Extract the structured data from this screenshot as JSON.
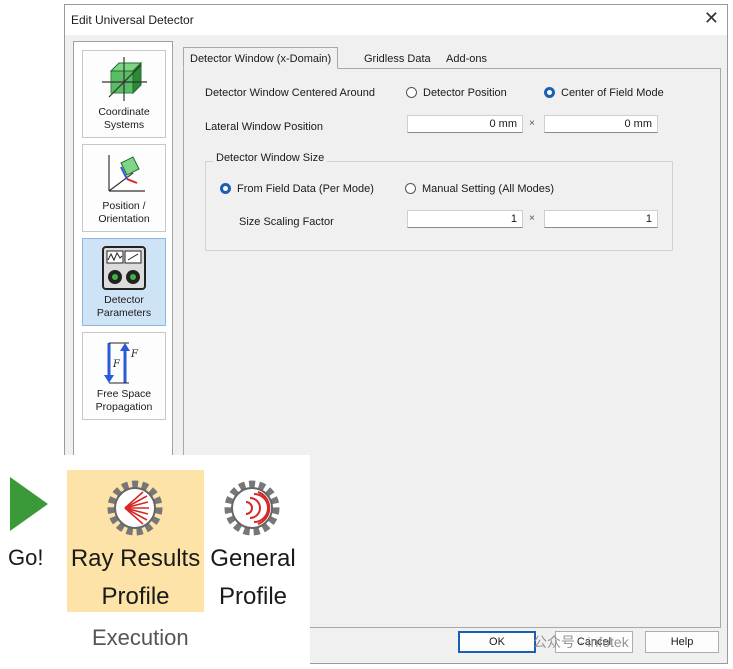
{
  "dialog": {
    "title": "Edit Universal Detector",
    "close_glyph": "✕"
  },
  "sidebar": {
    "items": [
      {
        "label_line1": "Coordinate",
        "label_line2": "Systems",
        "icon": "coordinate-systems-icon"
      },
      {
        "label_line1": "Position /",
        "label_line2": "Orientation",
        "icon": "position-orientation-icon"
      },
      {
        "label_line1": "Detector",
        "label_line2": "Parameters",
        "icon": "detector-parameters-icon",
        "selected": true
      },
      {
        "label_line1": "Free Space",
        "label_line2": "Propagation",
        "icon": "free-space-propagation-icon"
      }
    ]
  },
  "tabs": [
    {
      "label": "Detector Window (x-Domain)",
      "active": true
    },
    {
      "label": "Gridless Data",
      "active": false
    },
    {
      "label": "Add-ons",
      "active": false
    }
  ],
  "form": {
    "centered_around_label": "Detector Window Centered Around",
    "radio_detector_position": "Detector Position",
    "radio_center_field_mode": "Center of Field Mode",
    "center_selected": "Center of Field Mode",
    "lateral_position_label": "Lateral Window Position",
    "lateral_x": "0 mm",
    "lateral_y": "0 mm",
    "times_sign": "×",
    "size_group_title": "Detector Window Size",
    "radio_from_field": "From Field Data (Per Mode)",
    "radio_manual": "Manual Setting (All Modes)",
    "size_selected": "From Field Data (Per Mode)",
    "scaling_label": "Size Scaling Factor",
    "scaling_x": "1",
    "scaling_y": "1"
  },
  "buttons": {
    "ok": "OK",
    "cancel": "Cancel",
    "help": "Help"
  },
  "ribbon": {
    "go_label": "Go!",
    "ray_results_line1": "Ray Results",
    "ray_results_line2": "Profile",
    "general_line1": "General",
    "general_line2": "Profile",
    "group_label": "Execution",
    "highlight_color": "#fde3a7",
    "go_color": "#3a9a3a"
  },
  "watermark": "公众号 · infotek",
  "colors": {
    "accent": "#1a5fb4",
    "selected_sidebar": "#cfe3f6"
  }
}
